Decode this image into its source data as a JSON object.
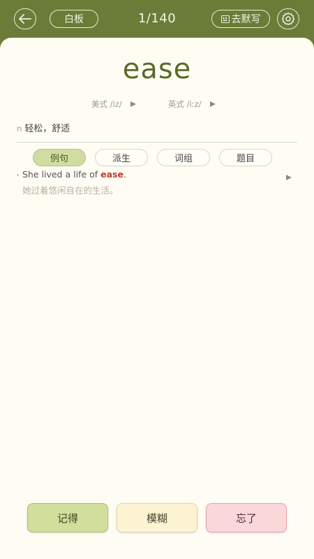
{
  "header": {
    "back_icon": "arrow-left-icon",
    "whiteboard_label": "白板",
    "progress": "1/140",
    "dictation_label": "去默写",
    "dictation_icon": "keyboard-icon",
    "settings_icon": "gear-icon"
  },
  "word": {
    "text": "ease",
    "us_phonetic": "美式 /iz/",
    "uk_phonetic": "英式 /iːz/",
    "pos": "n",
    "meaning": "轻松，舒适"
  },
  "tabs": [
    {
      "label": "例句",
      "active": true
    },
    {
      "label": "派生",
      "active": false
    },
    {
      "label": "词组",
      "active": false
    },
    {
      "label": "题目",
      "active": false
    }
  ],
  "example": {
    "en_before": "She lived a life of ",
    "en_highlight": "ease",
    "en_after": ".",
    "zh": "她过着悠闲自在的生活。"
  },
  "actions": {
    "know_label": "记得",
    "fuzzy_label": "模糊",
    "forgot_label": "忘了"
  },
  "colors": {
    "header_bg": "#6b7c38",
    "word_color": "#5b6a2a",
    "highlight": "#c0392b",
    "know_bg": "#d2de9c",
    "fuzzy_bg": "#fbf3d2",
    "forgot_bg": "#fad7d9"
  }
}
